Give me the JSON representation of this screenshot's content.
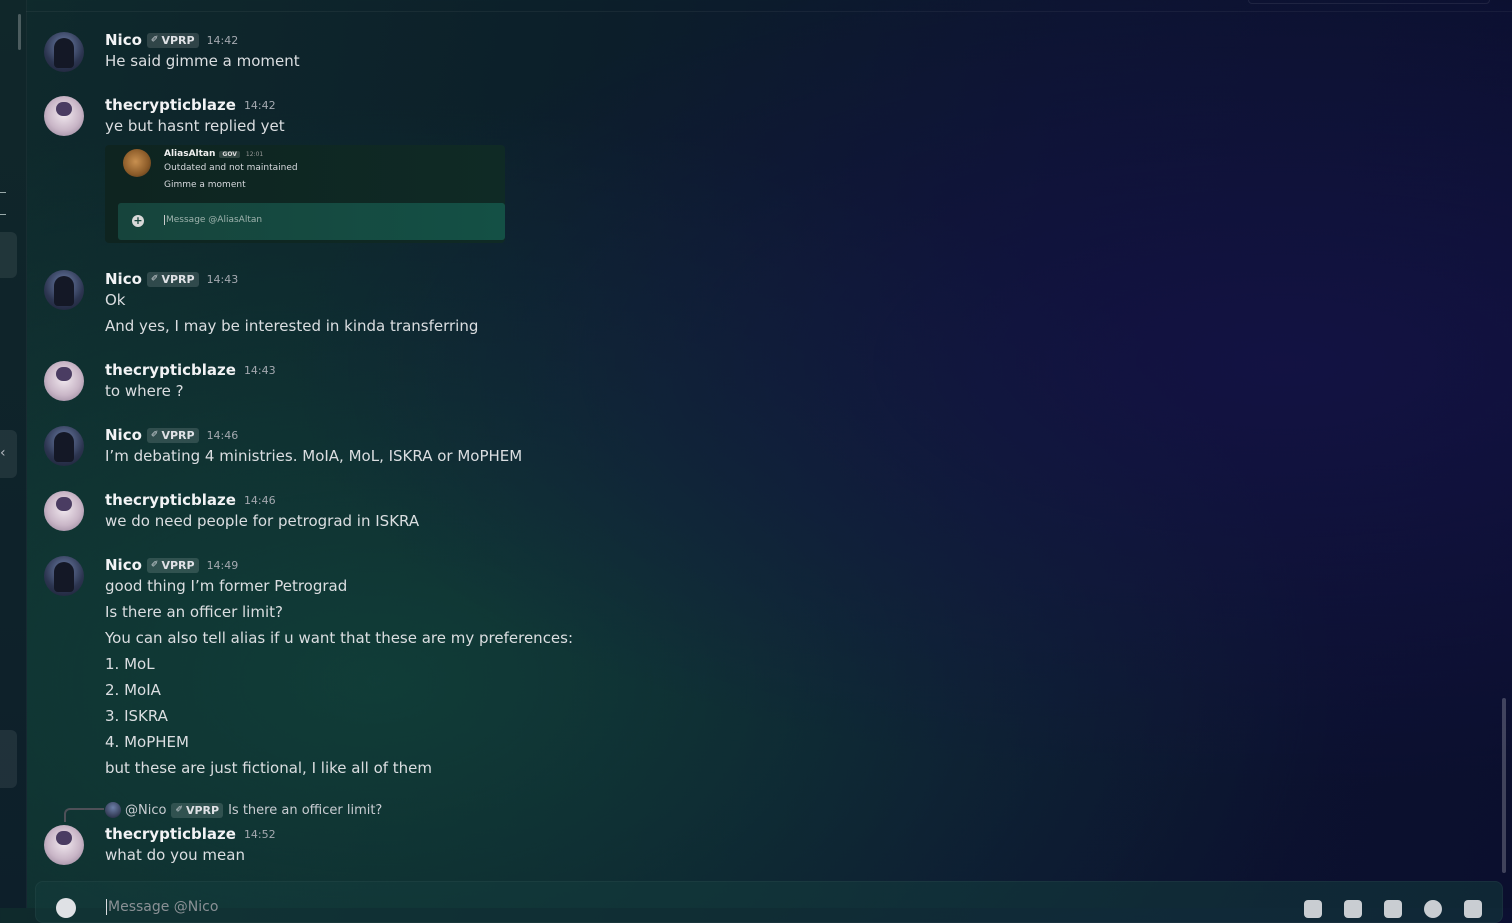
{
  "messages": [
    {
      "user": "Nico",
      "tag": "VPRP",
      "time": "14:42",
      "lines": [
        "He said gimme a moment"
      ]
    },
    {
      "user": "thecrypticblaze",
      "time": "14:42",
      "lines": [
        "ye but hasnt replied yet"
      ]
    },
    {
      "user": "Nico",
      "tag": "VPRP",
      "time": "14:43",
      "lines": [
        "Ok",
        "And yes, I may be interested in kinda transferring"
      ]
    },
    {
      "user": "thecrypticblaze",
      "time": "14:43",
      "lines": [
        "to where ?"
      ]
    },
    {
      "user": "Nico",
      "tag": "VPRP",
      "time": "14:46",
      "lines": [
        "I’m debating 4 ministries. MoIA, MoL, ISKRA or MoPHEM"
      ]
    },
    {
      "user": "thecrypticblaze",
      "time": "14:46",
      "lines": [
        "we do need people for petrograd in ISKRA"
      ]
    },
    {
      "user": "Nico",
      "tag": "VPRP",
      "time": "14:49",
      "lines": [
        "good thing I’m former Petrograd",
        "Is there an officer limit?",
        "You can also tell alias if u want that these are my preferences:",
        "1. MoL",
        "2. MoIA",
        "3. ISKRA",
        "4. MoPHEM",
        "but these are just fictional, I like all of them"
      ]
    },
    {
      "user": "thecrypticblaze",
      "time": "14:52",
      "lines": [
        "what do you mean"
      ]
    }
  ],
  "embed": {
    "user": "AliasAltan",
    "tag": "GOV",
    "time": "12:01",
    "lines": [
      "Outdated and not maintained",
      "Gimme a moment"
    ],
    "placeholder": "Message @AliasAltan"
  },
  "reply": {
    "user": "@Nico",
    "tag": "VPRP",
    "text": "Is there an officer limit?"
  },
  "composer": {
    "placeholder": "Message @Nico"
  }
}
